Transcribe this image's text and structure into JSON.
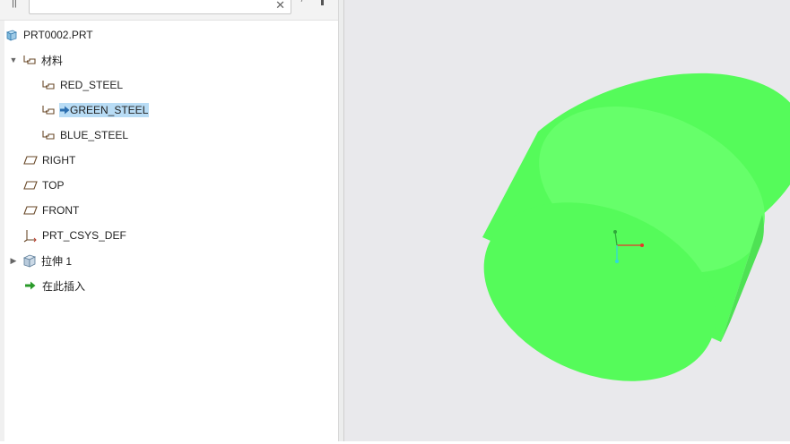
{
  "model_tree": {
    "search": {
      "value": "",
      "placeholder": ""
    },
    "root": {
      "label": "PRT0002.PRT",
      "icon": "part-cube-icon"
    },
    "materials_folder": {
      "label": "材料",
      "icon": "material-tag-icon",
      "expanded": true
    },
    "materials": [
      {
        "label": "RED_STEEL",
        "icon": "material-tag-icon",
        "current": false
      },
      {
        "label": "GREEN_STEEL",
        "icon": "material-tag-icon",
        "current": true
      },
      {
        "label": "BLUE_STEEL",
        "icon": "material-tag-icon",
        "current": false
      }
    ],
    "datum_planes": [
      {
        "label": "RIGHT",
        "icon": "datum-plane-icon"
      },
      {
        "label": "TOP",
        "icon": "datum-plane-icon"
      },
      {
        "label": "FRONT",
        "icon": "datum-plane-icon"
      }
    ],
    "csys": {
      "label": "PRT_CSYS_DEF",
      "icon": "coordinate-system-icon"
    },
    "extrude": {
      "label": "拉伸 1",
      "icon": "extrude-feature-icon",
      "expanded": false
    },
    "insert_here": {
      "label": "在此插入",
      "icon": "insert-arrow-icon"
    }
  },
  "viewport": {
    "background": "#e9e9ec",
    "model_color": "#55fb5a",
    "model_side_color": "#4ee254",
    "csys_colors": {
      "x": "#e8342a",
      "y": "#2ea83a",
      "z": "#2fd8e0"
    }
  },
  "colors": {
    "selection_bg": "#b8dcf5",
    "panel_bg": "#ffffff"
  }
}
